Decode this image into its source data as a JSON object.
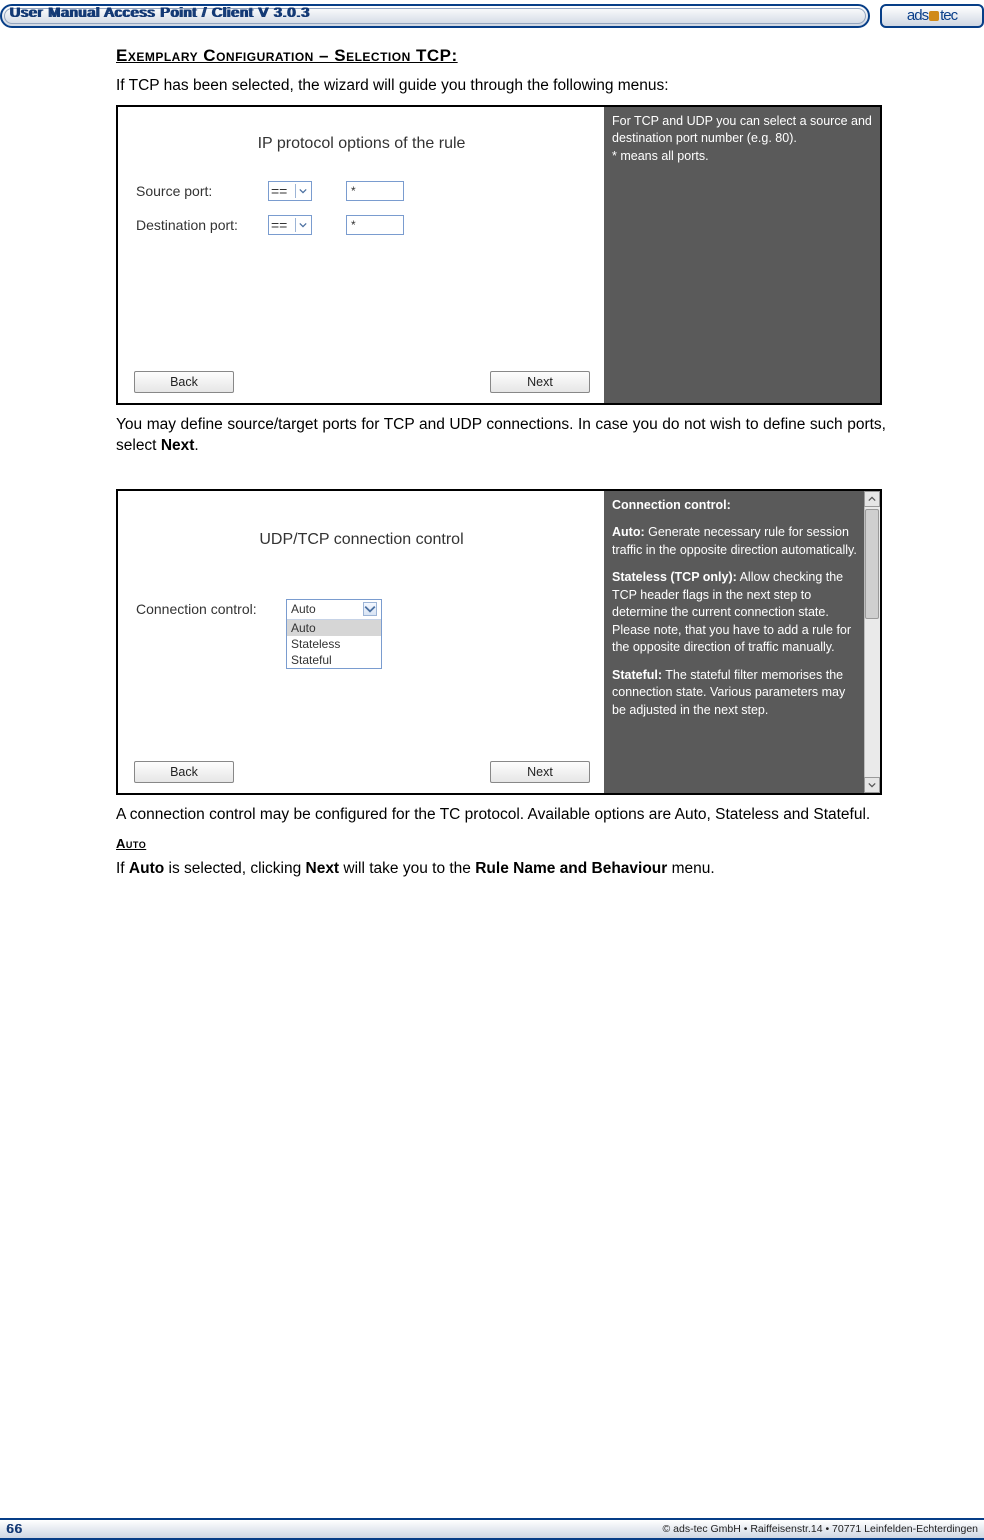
{
  "header": {
    "title": "User Manual Access Point / Client V 3.0.3",
    "logo_text_a": "ads",
    "logo_text_b": "tec"
  },
  "section1": {
    "heading": "Exemplary Configuration – Selection TCP:",
    "intro": "If TCP has been selected, the wizard will guide you through the following menus:"
  },
  "panel1": {
    "title": "IP protocol options of the rule",
    "row1_label": "Source port:",
    "row1_sel": "==",
    "row1_val": "*",
    "row2_label": "Destination port:",
    "row2_sel": "==",
    "row2_val": "*",
    "back": "Back",
    "next": "Next",
    "help": "For TCP and UDP you can select a source and destination port number (e.g. 80).\n* means all ports."
  },
  "between1": "You may define source/target ports for TCP and UDP connections. In case you do not wish to define such ports, select ",
  "between1_bold": "Next",
  "between1_end": ".",
  "panel2": {
    "title": "UDP/TCP connection control",
    "row_label": "Connection control:",
    "sel_top": "Auto",
    "opts": [
      "Auto",
      "Stateless",
      "Stateful"
    ],
    "back": "Back",
    "next": "Next",
    "help_h1": "Connection control:",
    "help_h2": "Auto:",
    "help_t2": " Generate necessary rule for session traffic in the opposite direction automatically.",
    "help_h3": "Stateless (TCP only):",
    "help_t3": " Allow checking the TCP header flags in the next step to determine the current connection state. Please note, that you have to add a rule for the opposite direction of traffic manually.",
    "help_h4": "Stateful:",
    "help_t4": " The stateful filter memorises the connection state. Various parameters may be adjusted in the next step."
  },
  "after2": "A connection control may be configured for the TC protocol. Available options are Auto, Stateless and Stateful.",
  "auto_heading": "Auto",
  "auto_text_a": "If ",
  "auto_text_b": "Auto",
  "auto_text_c": " is selected, clicking ",
  "auto_text_d": "Next",
  "auto_text_e": " will take you to the ",
  "auto_text_f": "Rule Name and Behaviour",
  "auto_text_g": " menu.",
  "footer": {
    "page": "66",
    "copyright": "© ads-tec GmbH • Raiffeisenstr.14 • 70771 Leinfelden-Echterdingen"
  }
}
